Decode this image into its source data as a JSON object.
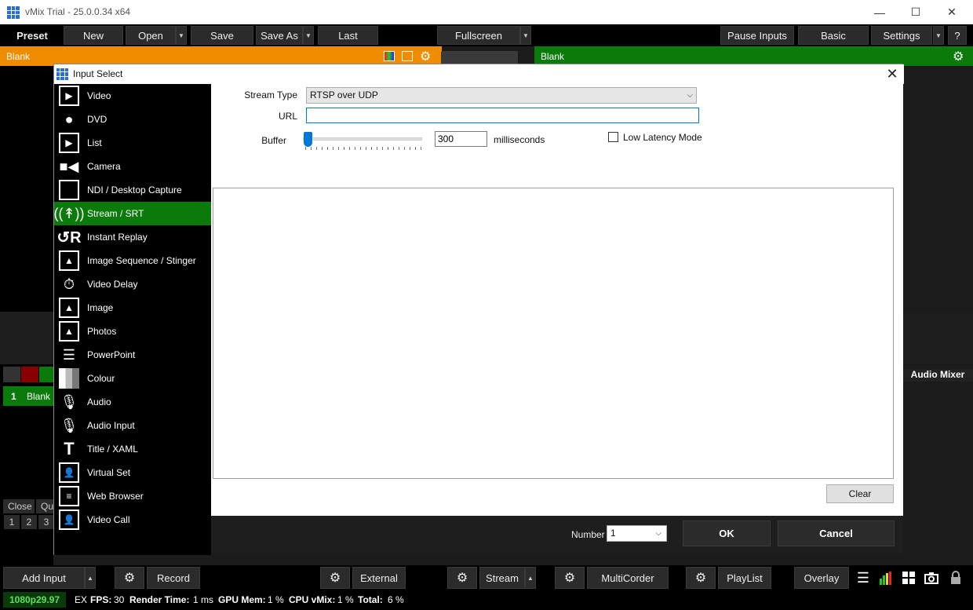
{
  "window": {
    "title": "vMix Trial - 25.0.0.34 x64",
    "minimize": "—",
    "maximize": "☐",
    "close": "✕"
  },
  "toolbar": {
    "preset": "Preset",
    "new": "New",
    "open": "Open",
    "save": "Save",
    "save_as": "Save As",
    "last": "Last",
    "fullscreen": "Fullscreen",
    "pause_inputs": "Pause Inputs",
    "basic": "Basic",
    "settings": "Settings",
    "help": "?"
  },
  "preview": {
    "label": "Blank"
  },
  "output": {
    "label": "Blank"
  },
  "background": {
    "input_tile_number": "1",
    "input_tile_label": "Blank",
    "close_label": "Close",
    "qu_label": "Qu",
    "numbers": [
      "1",
      "2",
      "3"
    ],
    "audio_mixer": "Audio Mixer"
  },
  "dialog": {
    "title": "Input Select",
    "categories": [
      {
        "label": "Video",
        "icon": "video-icon"
      },
      {
        "label": "DVD",
        "icon": "dvd-icon"
      },
      {
        "label": "List",
        "icon": "list-icon"
      },
      {
        "label": "Camera",
        "icon": "camera-icon"
      },
      {
        "label": "NDI / Desktop Capture",
        "icon": "monitor-icon"
      },
      {
        "label": "Stream / SRT",
        "icon": "antenna-icon"
      },
      {
        "label": "Instant Replay",
        "icon": "replay-icon"
      },
      {
        "label": "Image Sequence / Stinger",
        "icon": "image-sequence-icon"
      },
      {
        "label": "Video Delay",
        "icon": "stopwatch-icon"
      },
      {
        "label": "Image",
        "icon": "image-icon"
      },
      {
        "label": "Photos",
        "icon": "photos-icon"
      },
      {
        "label": "PowerPoint",
        "icon": "powerpoint-icon"
      },
      {
        "label": "Colour",
        "icon": "colour-icon"
      },
      {
        "label": "Audio",
        "icon": "microphone-icon"
      },
      {
        "label": "Audio Input",
        "icon": "microphone-icon"
      },
      {
        "label": "Title / XAML",
        "icon": "title-icon"
      },
      {
        "label": "Virtual Set",
        "icon": "virtual-set-icon"
      },
      {
        "label": "Web Browser",
        "icon": "web-browser-icon"
      },
      {
        "label": "Video Call",
        "icon": "video-call-icon"
      }
    ],
    "selected_category": "Stream / SRT",
    "form": {
      "stream_type_label": "Stream Type",
      "stream_type_value": "RTSP over UDP",
      "url_label": "URL",
      "url_value": "",
      "buffer_label": "Buffer",
      "buffer_value": "300",
      "buffer_unit": "milliseconds",
      "low_latency_label": "Low Latency Mode",
      "low_latency_checked": false,
      "clear": "Clear"
    },
    "footer": {
      "number_label": "Number",
      "number_value": "1",
      "ok": "OK",
      "cancel": "Cancel"
    }
  },
  "bottombar": {
    "add_input": "Add Input",
    "record": "Record",
    "external": "External",
    "stream": "Stream",
    "multicorder": "MultiCorder",
    "playlist": "PlayList",
    "overlay": "Overlay"
  },
  "statusbar": {
    "format": "1080p29.97",
    "ex": "EX",
    "fps_label": "FPS:",
    "fps_value": "30",
    "render_label": "Render Time:",
    "render_value": "1 ms",
    "gpu_label": "GPU Mem:",
    "gpu_value": "1 %",
    "cpu_label": "CPU vMix:",
    "cpu_value": "1 %",
    "total_label": "Total:",
    "total_value": "6 %"
  },
  "colors": {
    "preview": "#f08c00",
    "output_green": "#0a7a0a",
    "accent_blue": "#0078d7"
  }
}
